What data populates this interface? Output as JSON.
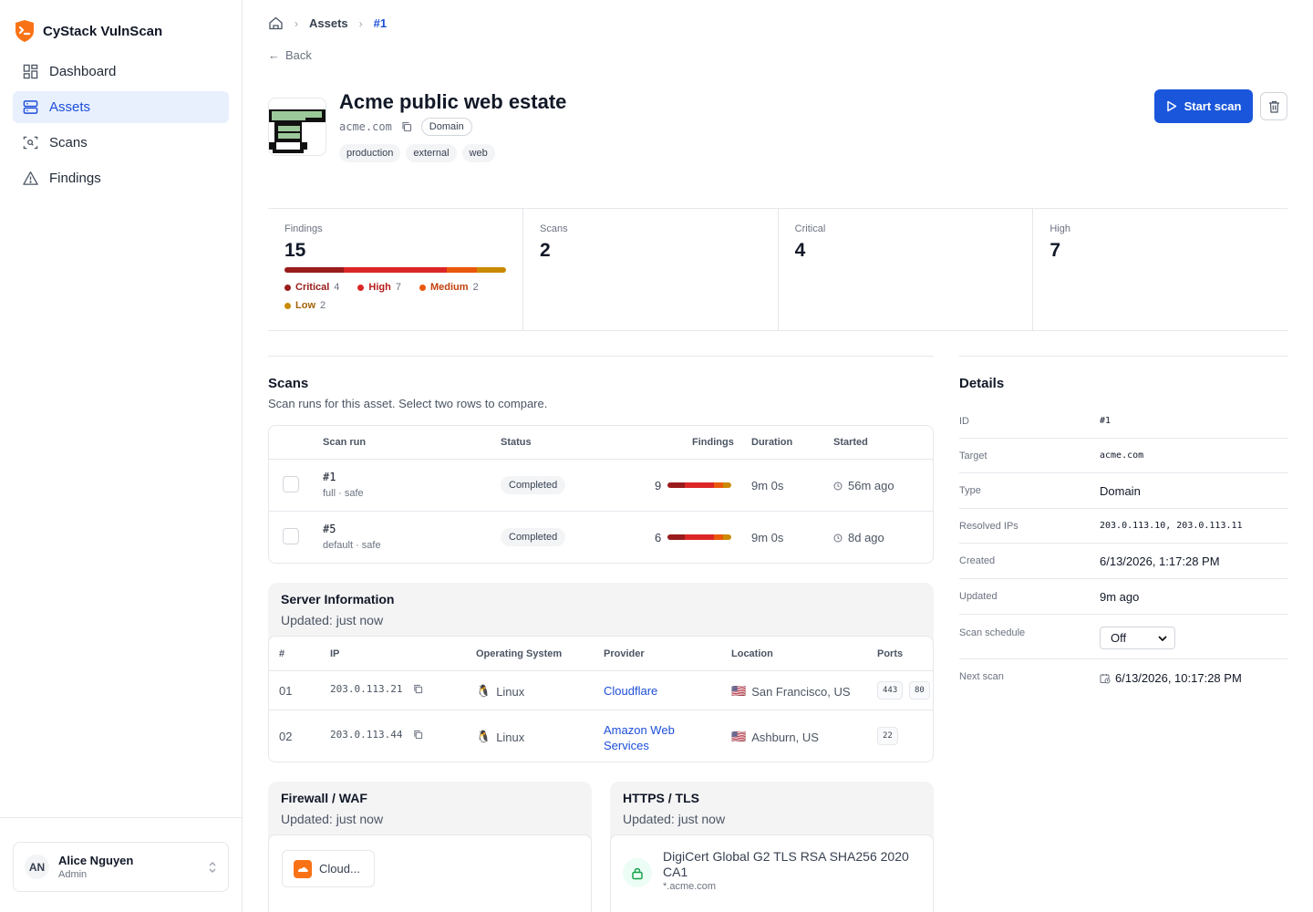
{
  "app": {
    "name": "CyStack VulnScan"
  },
  "sidebar": {
    "items": [
      {
        "label": "Dashboard",
        "icon": "dashboard-icon"
      },
      {
        "label": "Assets",
        "icon": "server-icon"
      },
      {
        "label": "Scans",
        "icon": "scan-icon"
      },
      {
        "label": "Findings",
        "icon": "warning-icon"
      }
    ],
    "active": "Assets",
    "user": {
      "initials": "AN",
      "name": "Alice Nguyen",
      "role": "Admin"
    }
  },
  "breadcrumb": {
    "items": [
      "Assets",
      "#1"
    ]
  },
  "back_label": "Back",
  "asset": {
    "title": "Acme public web estate",
    "host": "acme.com",
    "type_badge": "Domain",
    "tags": [
      "production",
      "external",
      "web"
    ],
    "start_scan_label": "Start scan"
  },
  "stats": {
    "findings": {
      "label": "Findings",
      "value": "15"
    },
    "scans": {
      "label": "Scans",
      "value": "2"
    },
    "critical": {
      "label": "Critical",
      "value": "4"
    },
    "high": {
      "label": "High",
      "value": "7"
    },
    "severity": [
      {
        "name": "Critical",
        "count": 4,
        "color": "#991b1b"
      },
      {
        "name": "High",
        "count": 7,
        "color": "#dc2626"
      },
      {
        "name": "Medium",
        "count": 2,
        "color": "#ea580c"
      },
      {
        "name": "Low",
        "count": 2,
        "color": "#ca8a04"
      }
    ]
  },
  "scans_section": {
    "title": "Scans",
    "subtitle": "Scan runs for this asset. Select two rows to compare.",
    "columns": [
      "Scan run",
      "Status",
      "Findings",
      "Duration",
      "Started"
    ],
    "rows": [
      {
        "id": "#1",
        "meta": "full · safe",
        "status": "Completed",
        "findings": "9",
        "duration": "9m 0s",
        "started": "56m ago"
      },
      {
        "id": "#5",
        "meta": "default · safe",
        "status": "Completed",
        "findings": "6",
        "duration": "9m 0s",
        "started": "8d ago"
      }
    ]
  },
  "server_info": {
    "title": "Server Information",
    "updated": "Updated: just now",
    "columns": [
      "#",
      "IP",
      "Operating System",
      "Provider",
      "Location",
      "Ports"
    ],
    "rows": [
      {
        "n": "01",
        "ip": "203.0.113.21",
        "os": "Linux",
        "provider": "Cloudflare",
        "location": "San Francisco, US",
        "ports": [
          "443",
          "80"
        ]
      },
      {
        "n": "02",
        "ip": "203.0.113.44",
        "os": "Linux",
        "provider": "Amazon Web Services",
        "location": "Ashburn, US",
        "ports": [
          "22"
        ]
      }
    ]
  },
  "firewall": {
    "title": "Firewall / WAF",
    "updated": "Updated: just now",
    "item": "Cloud..."
  },
  "tls": {
    "title": "HTTPS / TLS",
    "updated": "Updated: just now",
    "issuer": "DigiCert Global G2 TLS RSA SHA256 2020 CA1",
    "subject": "*.acme.com"
  },
  "details": {
    "title": "Details",
    "rows": [
      {
        "label": "ID",
        "value": "#1",
        "mono": true
      },
      {
        "label": "Target",
        "value": "acme.com",
        "mono": true
      },
      {
        "label": "Type",
        "value": "Domain",
        "mono": false
      },
      {
        "label": "Resolved IPs",
        "value": "203.0.113.10, 203.0.113.11",
        "mono": true
      },
      {
        "label": "Created",
        "value": "6/13/2026, 1:17:28 PM",
        "mono": false
      },
      {
        "label": "Updated",
        "value": "9m ago",
        "mono": false
      },
      {
        "label": "Scan schedule",
        "value": "Off",
        "mono": false
      },
      {
        "label": "Next scan",
        "value": "6/13/2026, 10:17:28 PM",
        "mono": false
      }
    ]
  }
}
